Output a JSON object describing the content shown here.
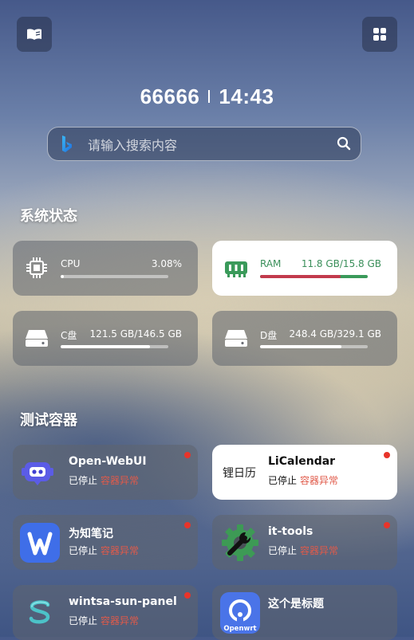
{
  "clock": {
    "text": "66666",
    "time": "14:43"
  },
  "search": {
    "placeholder": "请输入搜索内容"
  },
  "sections": {
    "system": "系统状态",
    "test": "测试容器"
  },
  "stats": [
    {
      "label": "CPU",
      "value": "3.08%",
      "percent": 3.08
    },
    {
      "label": "RAM",
      "value": "11.8 GB/15.8 GB",
      "percent": 74.7
    },
    {
      "label": "C盘",
      "value": "121.5 GB/146.5 GB",
      "percent": 82.9
    },
    {
      "label": "D盘",
      "value": "248.4 GB/329.1 GB",
      "percent": 75.5
    }
  ],
  "apps": [
    {
      "name": "Open-WebUI",
      "state": "已停止",
      "error": "容器异常",
      "icon": "robot-icon"
    },
    {
      "name": "LiCalendar",
      "state": "已停止",
      "error": "容器异常",
      "icon_text": "锂日历"
    },
    {
      "name": "为知笔记",
      "state": "已停止",
      "error": "容器异常",
      "icon": "wiz-note-icon"
    },
    {
      "name": "it-tools",
      "state": "已停止",
      "error": "容器异常",
      "icon": "gear-wrench-icon"
    },
    {
      "name": "wintsa-sun-panel",
      "state": "已停止",
      "error": "容器异常",
      "icon": "sun-panel-icon"
    },
    {
      "name": "这个是标题",
      "icon": "openwrt-icon",
      "icon_text": "Openwrt"
    }
  ],
  "colors": {
    "accent_red": "#e8342a",
    "ram_green": "#3a9a5a",
    "ram_red": "#c23a4c",
    "error_text": "#e05a4a"
  }
}
